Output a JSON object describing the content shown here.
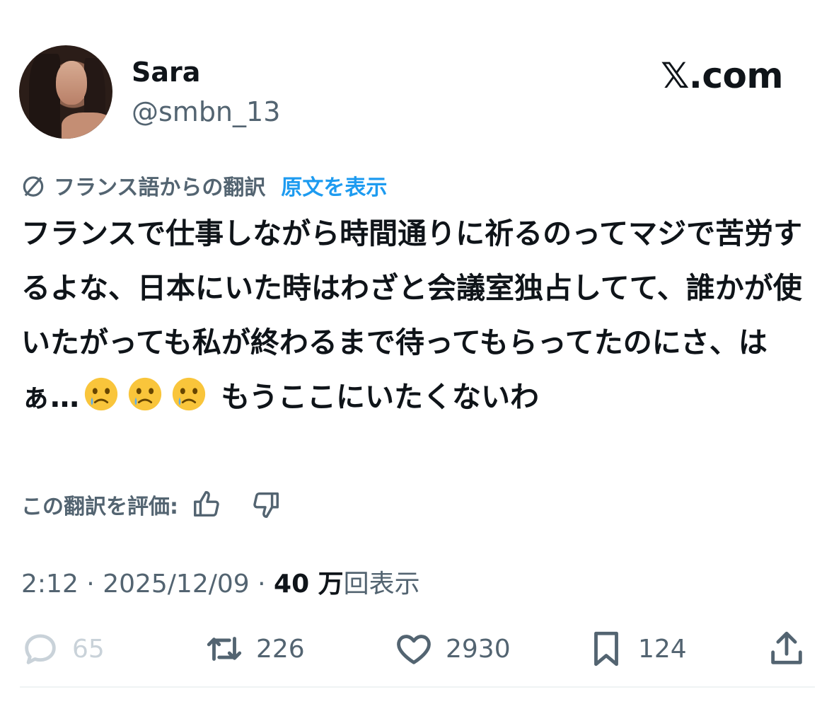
{
  "header": {
    "name": "Sara",
    "handle": "@smbn_13",
    "brand": "𝕏.com"
  },
  "translation": {
    "label": "フランス語からの翻訳",
    "show_original": "原文を表示"
  },
  "tweet": {
    "text_part1": "フランスで仕事しながら時間通りに祈るのってマジで苦労するよな、日本にいた時はわざと会議室独占してて、誰かが使いたがっても私が終わるまで待ってもらってたのにさ、はぁ…",
    "emoji_name": "face-holding-back-tears",
    "text_part2": " もうここにいたくないわ"
  },
  "rating": {
    "label": "この翻訳を評価:"
  },
  "meta": {
    "time": "2:12",
    "sep1": " · ",
    "date": "2025/12/09",
    "sep2": " · ",
    "views_count": "40 万",
    "views_label": "回表示"
  },
  "actions": {
    "replies": "65",
    "reposts": "226",
    "likes": "2930",
    "bookmarks": "124"
  },
  "colors": {
    "text": "#0f1419",
    "secondary": "#536471",
    "link": "#1d9bf0",
    "divider": "#eff3f4"
  }
}
